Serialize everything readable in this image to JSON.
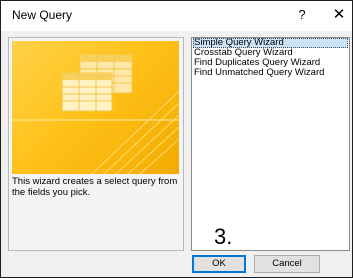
{
  "window": {
    "title": "New Query",
    "help_glyph": "?",
    "close_glyph": "✕"
  },
  "left_panel": {
    "description": "This wizard creates a select query from the fields you pick."
  },
  "wizards": {
    "items": [
      {
        "label": "Simple Query Wizard",
        "selected": true
      },
      {
        "label": "Crosstab Query Wizard",
        "selected": false
      },
      {
        "label": "Find Duplicates Query Wizard",
        "selected": false
      },
      {
        "label": "Find Unmatched Query Wizard",
        "selected": false
      }
    ]
  },
  "annotation": {
    "step_label": "3."
  },
  "buttons": {
    "ok_label": "OK",
    "cancel_label": "Cancel"
  },
  "colors": {
    "accent": "#0078d7",
    "selection": "#cce4f7",
    "illustration": "#ffc21a"
  }
}
